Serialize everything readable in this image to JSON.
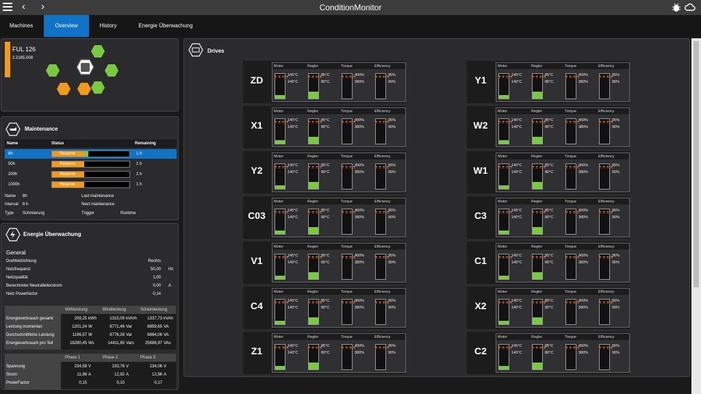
{
  "app": {
    "title": "ConditionMonitor",
    "back": "‹",
    "forward": "›"
  },
  "tabs": [
    {
      "label": "Machines"
    },
    {
      "label": "Overview"
    },
    {
      "label": "History"
    },
    {
      "label": "Energie Überwachung"
    }
  ],
  "machine": {
    "name": "FUL 126",
    "id": "2.2165.008"
  },
  "maintenance": {
    "title": "Maintenance",
    "headers": {
      "name": "Name",
      "status": "Status",
      "remaining": "Remaining"
    },
    "rows": [
      {
        "name": "8h",
        "status": "Reserve",
        "remaining": "1  h",
        "progress": 0.47
      },
      {
        "name": "50h",
        "status": "Reserve",
        "remaining": "1  h",
        "progress": 0.42
      },
      {
        "name": "200h",
        "status": "Reserve",
        "remaining": "1  h",
        "progress": 0.42
      },
      {
        "name": "1000h",
        "status": "Reserve",
        "remaining": "1  h",
        "progress": 0.42
      }
    ],
    "details": {
      "name_label": "Name",
      "name_value": "8h",
      "interval_label": "Interval",
      "interval_value": "8  h",
      "type_label": "Type",
      "type_value": "Schmierung",
      "last_label": "Last maintenance",
      "next_label": "Next maintenance",
      "trigger_label": "Trigger",
      "runtime_label": "Runtime"
    }
  },
  "energy": {
    "title": "Energie Überwachung",
    "general": "General",
    "props": [
      {
        "label": "Drehfeldrichtung",
        "value": "Rechts",
        "unit": ""
      },
      {
        "label": "Netzfrequenz",
        "value": "50,00",
        "unit": "Hz"
      },
      {
        "label": "Netzqualität",
        "value": "1,00",
        "unit": ""
      },
      {
        "label": "Berechneter Neutralleiterstrom",
        "value": "0,00",
        "unit": "A"
      },
      {
        "label": "Netz Powerfactor",
        "value": "0,14",
        "unit": ""
      }
    ],
    "power_headers": [
      "Wirkleistung",
      "Blindleistung",
      "Scheinleistung"
    ],
    "power_rows": [
      {
        "label": "Energieverbrauch gesamt",
        "v": [
          "209,25",
          "1315,09",
          "1337,73"
        ],
        "u": [
          "kWh",
          "kVArh",
          "kVAh"
        ]
      },
      {
        "label": "Leistung momentan",
        "v": [
          "1201,24",
          "8771,46",
          "8859,65"
        ],
        "u": [
          "W",
          "Var",
          "VA"
        ]
      },
      {
        "label": "Durchschnittliche Leistung",
        "v": [
          "1196,57",
          "8776,26",
          "8864,06"
        ],
        "u": [
          "W",
          "Var",
          "VA"
        ]
      },
      {
        "label": "Energieverbrauch pro Teil",
        "v": [
          "18280,45",
          "14411,65",
          "25686,97"
        ],
        "u": [
          "Ws",
          "Vars",
          "VAs"
        ]
      }
    ],
    "phase_headers": [
      "Phase 1",
      "Phase 2",
      "Phase 3"
    ],
    "phase_rows": [
      {
        "label": "Spannung",
        "v": [
          "234,59",
          "233,76",
          "234,06"
        ],
        "u": [
          "V",
          "V",
          "V"
        ]
      },
      {
        "label": "Strom",
        "v": [
          "11,96",
          "12,92",
          "12,96"
        ],
        "u": [
          "A",
          "A",
          "A"
        ]
      },
      {
        "label": "PowerFactor",
        "v": [
          "0,15",
          "0,10",
          "0,17"
        ],
        "u": [
          "",
          "",
          ""
        ]
      }
    ]
  },
  "drives": {
    "title": "Drives",
    "gauge_labels": [
      "Motor",
      "Regler",
      "Torque",
      "Efficiency"
    ],
    "gauge_values": {
      "motor": [
        "145°C",
        "140°C"
      ],
      "regler": [
        "85°C",
        "80°C"
      ],
      "torque": [
        "400%",
        "380%"
      ],
      "efficiency": [
        "95%",
        "90%"
      ]
    },
    "items": [
      "ZD",
      "X1",
      "Y2",
      "C03",
      "V1",
      "C4",
      "Z1",
      "Y1",
      "W2",
      "W1",
      "C3",
      "C1",
      "X2",
      "C2"
    ],
    "levels": {
      "motor": 0.15,
      "regler": 0.28,
      "torque": 0,
      "efficiency": 0
    }
  }
}
